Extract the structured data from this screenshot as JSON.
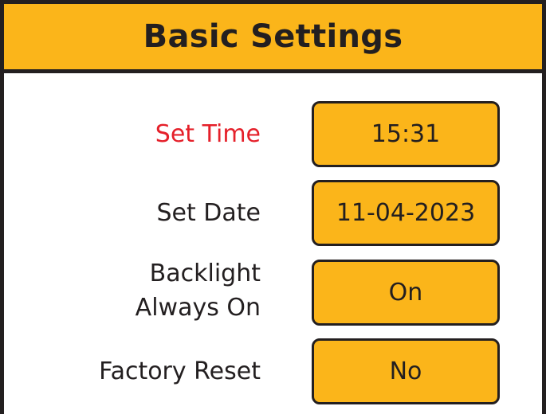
{
  "header": {
    "title": "Basic Settings"
  },
  "settings": {
    "time": {
      "label": "Set Time",
      "value": "15:31"
    },
    "date": {
      "label": "Set Date",
      "value": "11-04-2023"
    },
    "backlight": {
      "label_line1": "Backlight",
      "label_line2": "Always On",
      "value": "On"
    },
    "factory_reset": {
      "label": "Factory Reset",
      "value": "No"
    }
  },
  "colors": {
    "accent": "#fbb51a",
    "border": "#231f20",
    "active_label": "#e5202a",
    "background": "#ffffff"
  }
}
